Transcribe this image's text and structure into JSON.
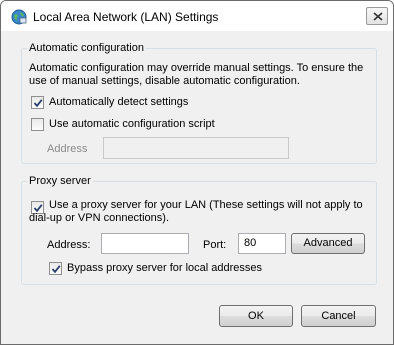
{
  "window": {
    "title": "Local Area Network (LAN) Settings",
    "icon": "network-globe-icon"
  },
  "auto_config": {
    "legend": "Automatic configuration",
    "description_line1": "Automatic configuration may override manual settings.  To ensure the",
    "description_line2": "use of manual settings, disable automatic configuration.",
    "auto_detect_label": "Automatically detect settings",
    "auto_detect_checked": true,
    "use_script_label": "Use automatic configuration script",
    "use_script_checked": false,
    "address_label": "Address",
    "address_value": ""
  },
  "proxy": {
    "legend": "Proxy server",
    "use_proxy_label_line1": "Use a proxy server for your LAN (These settings will not apply to",
    "use_proxy_label_line2": "dial-up or VPN connections).",
    "use_proxy_checked": true,
    "address_label": "Address:",
    "address_value": "",
    "port_label": "Port:",
    "port_value": "80",
    "advanced_label": "Advanced",
    "bypass_label": "Bypass proxy server for local addresses",
    "bypass_checked": true
  },
  "footer": {
    "ok_label": "OK",
    "cancel_label": "Cancel"
  }
}
